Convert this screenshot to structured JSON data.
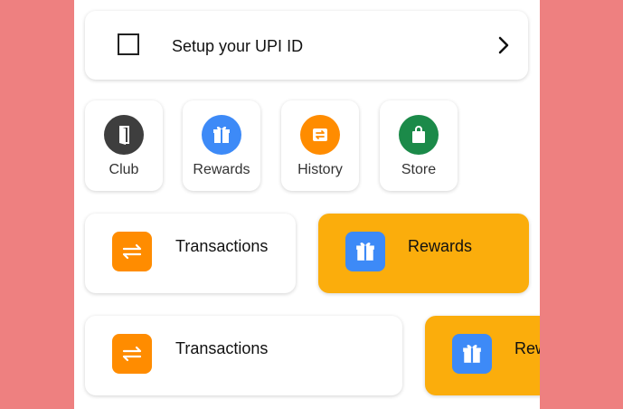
{
  "upi_card": {
    "label": "Setup your UPI ID",
    "icon": "chevron-right-icon"
  },
  "quick_links": [
    {
      "label": "Club",
      "icon": "door-icon",
      "color": "#3e3e3e"
    },
    {
      "label": "Rewards",
      "icon": "gift-icon",
      "color": "#3d8af7"
    },
    {
      "label": "History",
      "icon": "exchange-icon",
      "color": "#ff8c00"
    },
    {
      "label": "Store",
      "icon": "shopping-bag-icon",
      "color": "#1b8a49"
    }
  ],
  "row1": {
    "transactions": {
      "label": "Transactions",
      "icon": "exchange-icon",
      "color": "#ff8c00"
    },
    "rewards": {
      "label": "Rewards",
      "icon": "gift-icon",
      "color": "#3d8af7",
      "card_color": "#fbad0c"
    }
  },
  "row2": {
    "transactions": {
      "label": "Transactions",
      "icon": "exchange-icon",
      "color": "#ff8c00"
    },
    "rewards": {
      "label": "Rewards",
      "icon": "gift-icon",
      "color": "#3d8af7",
      "card_color": "#fbad0c"
    }
  }
}
